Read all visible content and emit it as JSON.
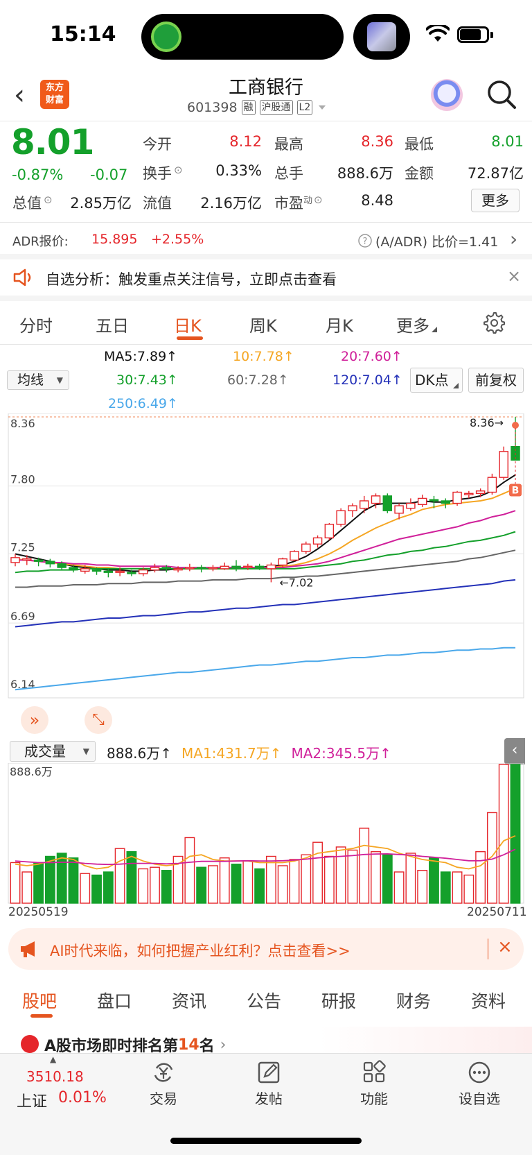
{
  "status_bar": {
    "time": "15:14"
  },
  "header": {
    "back": "‹",
    "logo_line1": "东方",
    "logo_line2": "财富",
    "name": "工商银行",
    "code": "601398",
    "tags": [
      "融",
      "沪股通",
      "L2"
    ]
  },
  "quote": {
    "price": "8.01",
    "change_pct": "-0.87%",
    "change_amt": "-0.07",
    "fields": [
      {
        "label": "今开",
        "value": "8.12",
        "color": "red"
      },
      {
        "label": "最高",
        "value": "8.36",
        "color": "red"
      },
      {
        "label": "最低",
        "value": "8.01",
        "color": "green"
      },
      {
        "label": "换手",
        "value": "0.33%",
        "color": "plain"
      },
      {
        "label": "总手",
        "value": "888.6万",
        "color": "plain"
      },
      {
        "label": "金额",
        "value": "72.87亿",
        "color": "plain"
      },
      {
        "label": "总值",
        "value": "2.85万亿",
        "color": "plain"
      },
      {
        "label": "流值",
        "value": "2.16万亿",
        "color": "plain"
      },
      {
        "label": "市盈",
        "value": "8.48",
        "color": "plain"
      }
    ],
    "pe_sup": "动",
    "more_label": "更多"
  },
  "adr": {
    "label": "ADR报价:",
    "price": "15.895",
    "change": "+2.55%",
    "ratio": "(A/ADR) 比价=1.41"
  },
  "notice": {
    "text": "自选分析：触发重点关注信号，立即点击查看",
    "close": "×"
  },
  "kline_tabs": [
    "分时",
    "五日",
    "日K",
    "周K",
    "月K",
    "更多"
  ],
  "active_tab": "日K",
  "ma": {
    "select": "均线",
    "items": [
      {
        "text": "MA5:7.89↑",
        "color": "#111111"
      },
      {
        "text": "10:7.78↑",
        "color": "#f5a623"
      },
      {
        "text": "20:7.60↑",
        "color": "#d0209a"
      },
      {
        "text": "30:7.43↑",
        "color": "#14a02b"
      },
      {
        "text": "60:7.28↑",
        "color": "#666666"
      },
      {
        "text": "120:7.04↑",
        "color": "#2431b8"
      },
      {
        "text": "250:6.49↑",
        "color": "#4aa8ea"
      }
    ],
    "dk_label": "DK点",
    "fq_label": "前复权"
  },
  "chart_data": {
    "type": "candlestick",
    "y_ticks": [
      "8.36",
      "7.80",
      "7.25",
      "6.69",
      "6.14"
    ],
    "ylim": [
      6.14,
      8.36
    ],
    "high_marker": "8.36",
    "low_marker": "7.02",
    "signal_badge": "B",
    "candles": [
      [
        7.18,
        7.22,
        7.15,
        7.25
      ],
      [
        7.2,
        7.21,
        7.16,
        7.24
      ],
      [
        7.2,
        7.19,
        7.15,
        7.22
      ],
      [
        7.19,
        7.17,
        7.14,
        7.21
      ],
      [
        7.17,
        7.14,
        7.12,
        7.19
      ],
      [
        7.14,
        7.12,
        7.1,
        7.16
      ],
      [
        7.11,
        7.13,
        7.09,
        7.16
      ],
      [
        7.12,
        7.11,
        7.08,
        7.14
      ],
      [
        7.11,
        7.1,
        7.06,
        7.13
      ],
      [
        7.1,
        7.11,
        7.07,
        7.14
      ],
      [
        7.1,
        7.09,
        7.07,
        7.12
      ],
      [
        7.09,
        7.12,
        7.07,
        7.14
      ],
      [
        7.12,
        7.14,
        7.1,
        7.17
      ],
      [
        7.14,
        7.13,
        7.1,
        7.16
      ],
      [
        7.12,
        7.13,
        7.1,
        7.15
      ],
      [
        7.13,
        7.14,
        7.11,
        7.17
      ],
      [
        7.14,
        7.13,
        7.1,
        7.16
      ],
      [
        7.13,
        7.14,
        7.11,
        7.16
      ],
      [
        7.13,
        7.15,
        7.12,
        7.18
      ],
      [
        7.15,
        7.14,
        7.11,
        7.2
      ],
      [
        7.14,
        7.15,
        7.12,
        7.17
      ],
      [
        7.15,
        7.14,
        7.12,
        7.17
      ],
      [
        7.13,
        7.16,
        7.02,
        7.18
      ],
      [
        7.16,
        7.21,
        7.14,
        7.22
      ],
      [
        7.2,
        7.27,
        7.19,
        7.28
      ],
      [
        7.27,
        7.33,
        7.25,
        7.35
      ],
      [
        7.33,
        7.38,
        7.3,
        7.4
      ],
      [
        7.38,
        7.49,
        7.36,
        7.5
      ],
      [
        7.49,
        7.6,
        7.47,
        7.62
      ],
      [
        7.6,
        7.64,
        7.55,
        7.66
      ],
      [
        7.62,
        7.68,
        7.58,
        7.72
      ],
      [
        7.66,
        7.72,
        7.62,
        7.74
      ],
      [
        7.72,
        7.6,
        7.58,
        7.74
      ],
      [
        7.58,
        7.64,
        7.53,
        7.66
      ],
      [
        7.62,
        7.66,
        7.6,
        7.7
      ],
      [
        7.65,
        7.7,
        7.63,
        7.73
      ],
      [
        7.69,
        7.68,
        7.62,
        7.72
      ],
      [
        7.68,
        7.66,
        7.62,
        7.7
      ],
      [
        7.66,
        7.75,
        7.64,
        7.76
      ],
      [
        7.73,
        7.74,
        7.7,
        7.76
      ],
      [
        7.74,
        7.76,
        7.71,
        7.78
      ],
      [
        7.75,
        7.87,
        7.73,
        7.9
      ],
      [
        7.87,
        8.08,
        7.85,
        8.12
      ],
      [
        8.12,
        8.01,
        8.01,
        8.36
      ]
    ],
    "ma_lines": [
      {
        "color": "#111111",
        "values": [
          7.25,
          7.23,
          7.21,
          7.19,
          7.17,
          7.15,
          7.14,
          7.13,
          7.12,
          7.12,
          7.11,
          7.11,
          7.12,
          7.12,
          7.13,
          7.13,
          7.13,
          7.13,
          7.14,
          7.14,
          7.14,
          7.14,
          7.15,
          7.16,
          7.19,
          7.23,
          7.29,
          7.36,
          7.44,
          7.52,
          7.6,
          7.65,
          7.66,
          7.66,
          7.66,
          7.68,
          7.67,
          7.67,
          7.69,
          7.7,
          7.72,
          7.76,
          7.83,
          7.89
        ]
      },
      {
        "color": "#f5a623",
        "values": [
          7.21,
          7.2,
          7.19,
          7.18,
          7.17,
          7.16,
          7.15,
          7.14,
          7.14,
          7.13,
          7.13,
          7.13,
          7.13,
          7.13,
          7.13,
          7.13,
          7.13,
          7.13,
          7.13,
          7.13,
          7.14,
          7.14,
          7.14,
          7.15,
          7.16,
          7.18,
          7.21,
          7.25,
          7.3,
          7.36,
          7.41,
          7.46,
          7.5,
          7.54,
          7.57,
          7.61,
          7.63,
          7.65,
          7.66,
          7.67,
          7.68,
          7.7,
          7.74,
          7.78
        ]
      },
      {
        "color": "#d0209a",
        "values": [
          7.2,
          7.2,
          7.19,
          7.18,
          7.18,
          7.17,
          7.17,
          7.16,
          7.16,
          7.15,
          7.15,
          7.15,
          7.15,
          7.15,
          7.14,
          7.14,
          7.14,
          7.14,
          7.14,
          7.14,
          7.14,
          7.14,
          7.14,
          7.14,
          7.15,
          7.16,
          7.17,
          7.19,
          7.22,
          7.25,
          7.28,
          7.31,
          7.34,
          7.37,
          7.39,
          7.41,
          7.43,
          7.45,
          7.47,
          7.5,
          7.52,
          7.55,
          7.57,
          7.6
        ]
      },
      {
        "color": "#14a02b",
        "values": [
          7.1,
          7.11,
          7.11,
          7.12,
          7.12,
          7.12,
          7.13,
          7.13,
          7.13,
          7.13,
          7.13,
          7.13,
          7.13,
          7.13,
          7.13,
          7.13,
          7.13,
          7.13,
          7.13,
          7.13,
          7.13,
          7.13,
          7.13,
          7.13,
          7.13,
          7.14,
          7.15,
          7.16,
          7.17,
          7.19,
          7.2,
          7.22,
          7.24,
          7.25,
          7.27,
          7.28,
          7.3,
          7.31,
          7.33,
          7.35,
          7.36,
          7.38,
          7.4,
          7.43
        ]
      },
      {
        "color": "#666666",
        "values": [
          6.98,
          6.98,
          6.99,
          6.99,
          6.99,
          7.0,
          7.0,
          7.0,
          7.01,
          7.01,
          7.01,
          7.02,
          7.02,
          7.02,
          7.03,
          7.03,
          7.03,
          7.04,
          7.04,
          7.04,
          7.05,
          7.05,
          7.05,
          7.06,
          7.06,
          7.07,
          7.07,
          7.08,
          7.09,
          7.1,
          7.11,
          7.12,
          7.13,
          7.14,
          7.15,
          7.16,
          7.17,
          7.18,
          7.19,
          7.21,
          7.22,
          7.24,
          7.26,
          7.28
        ]
      },
      {
        "color": "#2431b8",
        "values": [
          6.66,
          6.67,
          6.68,
          6.69,
          6.7,
          6.7,
          6.71,
          6.72,
          6.73,
          6.73,
          6.74,
          6.75,
          6.75,
          6.76,
          6.77,
          6.78,
          6.78,
          6.79,
          6.8,
          6.81,
          6.81,
          6.82,
          6.83,
          6.84,
          6.84,
          6.85,
          6.86,
          6.87,
          6.88,
          6.89,
          6.9,
          6.91,
          6.92,
          6.93,
          6.94,
          6.95,
          6.96,
          6.97,
          6.98,
          6.99,
          7.0,
          7.01,
          7.03,
          7.04
        ]
      },
      {
        "color": "#4aa8ea",
        "values": [
          6.15,
          6.16,
          6.17,
          6.18,
          6.19,
          6.2,
          6.21,
          6.22,
          6.23,
          6.24,
          6.25,
          6.26,
          6.27,
          6.28,
          6.29,
          6.29,
          6.3,
          6.31,
          6.32,
          6.33,
          6.34,
          6.35,
          6.35,
          6.36,
          6.37,
          6.38,
          6.38,
          6.39,
          6.4,
          6.41,
          6.41,
          6.42,
          6.43,
          6.43,
          6.44,
          6.45,
          6.45,
          6.46,
          6.47,
          6.47,
          6.48,
          6.48,
          6.49,
          6.49
        ]
      }
    ],
    "volume": {
      "select": "成交量",
      "legend": [
        {
          "text": "888.6万↑",
          "color": "#111111"
        },
        {
          "text": "MA1:431.7万↑",
          "color": "#f5a623"
        },
        {
          "text": "MA2:345.5万↑",
          "color": "#d0209a"
        }
      ],
      "max_label": "888.6万",
      "max": 888.6,
      "bars": [
        260,
        200,
        260,
        300,
        320,
        290,
        190,
        180,
        200,
        350,
        330,
        220,
        230,
        210,
        300,
        420,
        230,
        240,
        290,
        250,
        270,
        220,
        300,
        240,
        280,
        310,
        390,
        300,
        360,
        340,
        480,
        330,
        310,
        200,
        320,
        210,
        290,
        200,
        200,
        180,
        330,
        580,
        888.6,
        888.6
      ],
      "ma1": [
        250,
        240,
        250,
        270,
        290,
        280,
        240,
        220,
        230,
        270,
        300,
        270,
        250,
        240,
        250,
        300,
        310,
        280,
        270,
        270,
        270,
        260,
        260,
        260,
        270,
        290,
        320,
        330,
        340,
        350,
        370,
        360,
        350,
        320,
        300,
        280,
        270,
        260,
        230,
        220,
        240,
        300,
        400,
        431.7
      ],
      "ma2": [
        270,
        265,
        260,
        260,
        262,
        262,
        255,
        250,
        248,
        250,
        255,
        255,
        255,
        252,
        255,
        262,
        268,
        268,
        268,
        270,
        272,
        270,
        270,
        272,
        276,
        282,
        290,
        296,
        300,
        305,
        312,
        315,
        316,
        312,
        308,
        300,
        294,
        288,
        280,
        272,
        272,
        282,
        310,
        345.5
      ]
    },
    "x_start": "20250519",
    "x_end": "20250711"
  },
  "ai_banner": {
    "text": "AI时代来临，如何把握产业红利？点击查看>>",
    "close": "×"
  },
  "info_tabs": [
    "股吧",
    "盘口",
    "资讯",
    "公告",
    "研报",
    "财务",
    "资料"
  ],
  "rank": {
    "prefix": "A股市场即时排名第",
    "num": "14",
    "suffix": "名",
    "arrow": "›"
  },
  "bottom": {
    "index_value": "3510.18",
    "index_name": "上证",
    "index_change": "0.01%",
    "nav": [
      "交易",
      "发帖",
      "功能",
      "设自选"
    ]
  }
}
